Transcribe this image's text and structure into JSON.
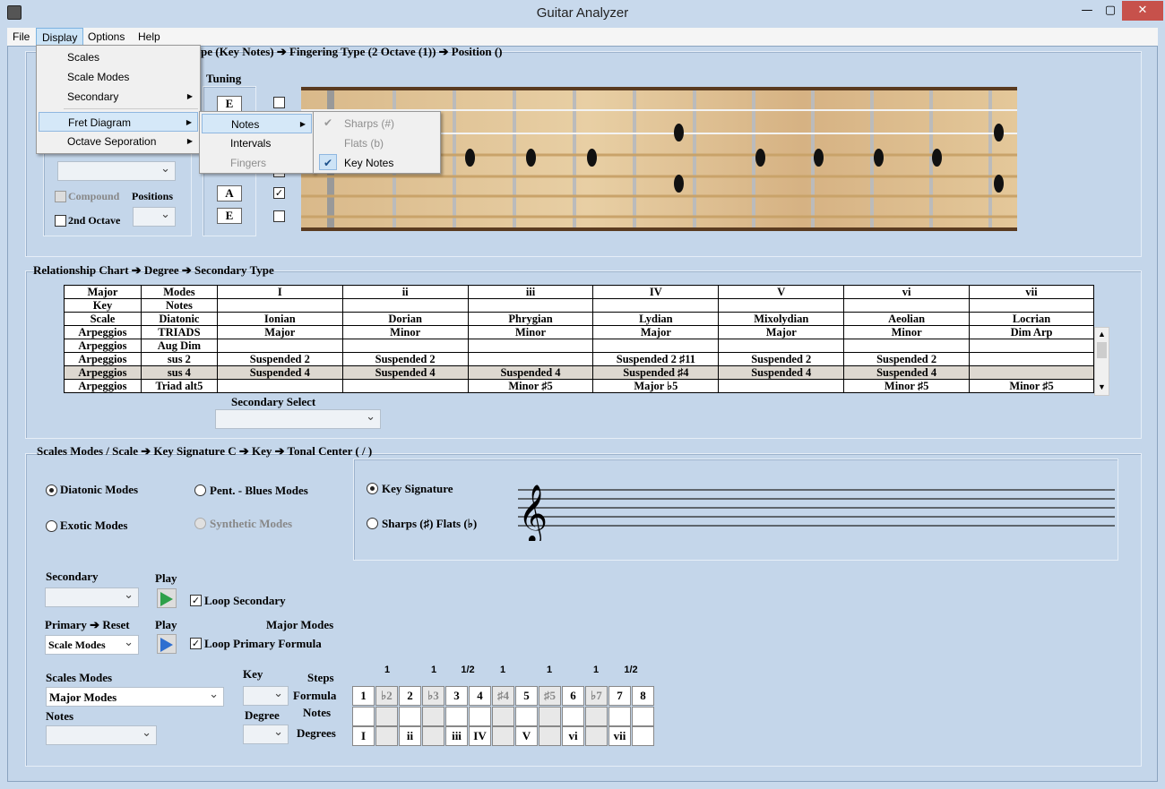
{
  "window": {
    "title": "Guitar Analyzer",
    "min": "—",
    "max": "▢",
    "close": "✕"
  },
  "menubar": [
    "File",
    "Display",
    "Options",
    "Help"
  ],
  "display_menu": [
    {
      "label": "Scales",
      "arrow": false
    },
    {
      "label": "Scale Modes",
      "arrow": false
    },
    {
      "label": "Secondary",
      "arrow": true
    },
    {
      "label": "Fret Diagram",
      "arrow": true
    },
    {
      "label": "Octave Seporation",
      "arrow": true
    }
  ],
  "fret_sub": [
    {
      "label": "Notes"
    },
    {
      "label": "Intervals"
    },
    {
      "label": "Fingers"
    }
  ],
  "notes_sub": [
    {
      "label": "Sharps (#)",
      "checked": true
    },
    {
      "label": "Flats (b)",
      "checked": false
    },
    {
      "label": "Key Notes",
      "checked": true
    }
  ],
  "header_breadcrumb": "pe (Key Notes)  ➔ Fingering Type (2 Octave (1))  ➔ Position  ()",
  "tuning": {
    "label": "Tuning",
    "strings": [
      "E",
      "",
      "",
      "",
      "A",
      "E"
    ],
    "checks": [
      false,
      false,
      false,
      false,
      true,
      false
    ]
  },
  "left_panel": {
    "compound": "Compound",
    "positions": "Positions",
    "second_octave": "2nd Octave"
  },
  "relationship": {
    "title": "Relationship Chart  ➔ Degree   ➔ Secondary Type",
    "header": [
      [
        "Major",
        "Modes",
        "I",
        "ii",
        "iii",
        "IV",
        "V",
        "vi",
        "vii"
      ],
      [
        "Key",
        "Notes",
        "",
        "",
        "",
        "",
        "",
        "",
        ""
      ],
      [
        "Scale",
        "Diatonic",
        "Ionian",
        "Dorian",
        "Phrygian",
        "Lydian",
        "Mixolydian",
        "Aeolian",
        "Locrian"
      ]
    ],
    "rows": [
      [
        "Arpeggios",
        "TRIADS",
        "Major",
        "Minor",
        "Minor",
        "Major",
        "Major",
        "Minor",
        "Dim Arp"
      ],
      [
        "Arpeggios",
        "Aug Dim",
        "",
        "",
        "",
        "",
        "",
        "",
        ""
      ],
      [
        "Arpeggios",
        "sus 2",
        "Suspended 2",
        "Suspended 2",
        "",
        "Suspended 2 ♯11",
        "Suspended 2",
        "Suspended 2",
        ""
      ],
      [
        "Arpeggios",
        "sus 4",
        "Suspended 4",
        "Suspended 4",
        "Suspended 4",
        "Suspended ♯4",
        "Suspended 4",
        "Suspended 4",
        ""
      ],
      [
        "Arpeggios",
        "Triad alt5",
        "",
        "",
        "Minor ♯5",
        "Major ♭5",
        "",
        "Minor ♯5",
        "Minor ♯5"
      ]
    ],
    "secondary_select": "Secondary Select"
  },
  "scales": {
    "title": "Scales Modes / Scale ➔ Key Signature C ➔ Key   ➔ Tonal Center   (   /   )",
    "diatonic": "Diatonic Modes",
    "pent": "Pent. - Blues Modes",
    "exotic": "Exotic Modes",
    "synthetic": "Synthetic Modes",
    "key_sig": "Key Signature",
    "sharps_flats": "Sharps (♯)   Flats (♭)",
    "secondary": "Secondary",
    "play": "Play",
    "loop_secondary": "Loop Secondary",
    "primary_reset": "Primary  ➔ Reset",
    "major_modes_lbl": "Major Modes",
    "scale_modes_dd": "Scale Modes",
    "loop_primary": "Loop  Primary Formula",
    "scales_modes": "Scales Modes",
    "major_modes_dd": "Major Modes",
    "notes": "Notes",
    "key": "Key",
    "degree": "Degree",
    "steps": "Steps",
    "formula": "Formula",
    "notes2": "Notes",
    "degrees": "Degrees",
    "play_icon": "Play"
  },
  "formula": {
    "steps": [
      "1",
      "1",
      "1/2",
      "1",
      "1",
      "1",
      "1/2"
    ],
    "cells": [
      {
        "t": "1",
        "g": false
      },
      {
        "t": "♭2",
        "g": true
      },
      {
        "t": "2",
        "g": false
      },
      {
        "t": "♭3",
        "g": true
      },
      {
        "t": "3",
        "g": false
      },
      {
        "t": "4",
        "g": false
      },
      {
        "t": "♯4",
        "g": true
      },
      {
        "t": "5",
        "g": false
      },
      {
        "t": "♯5",
        "g": true
      },
      {
        "t": "6",
        "g": false
      },
      {
        "t": "♭7",
        "g": true
      },
      {
        "t": "7",
        "g": false
      },
      {
        "t": "8",
        "g": false
      }
    ],
    "degrees": [
      "I",
      "",
      "ii",
      "",
      "iii",
      "IV",
      "",
      "V",
      "",
      "vi",
      "",
      "vii",
      ""
    ]
  }
}
